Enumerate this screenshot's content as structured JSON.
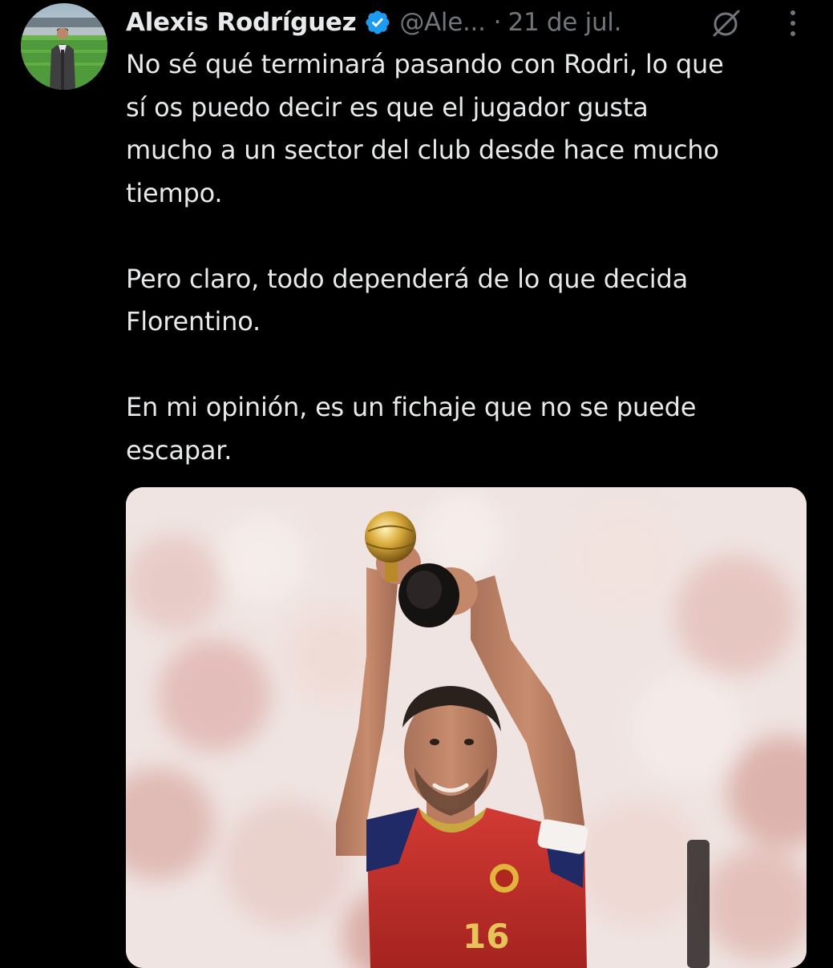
{
  "tweet": {
    "author": {
      "name": "Alexis Rodríguez",
      "handle": "@Ale...",
      "verified_icon": "verified-badge-icon",
      "avatar_icon": "avatar"
    },
    "separator": "·",
    "date": "21 de jul.",
    "paragraphs": [
      "No sé qué terminará pasando con Rodri, lo que\nsí os puedo decir es que el jugador gusta\nmucho a un sector del club desde hace mucho\ntiempo.",
      "Pero claro, todo dependerá de lo que decida\nFlorentino.",
      "En mi opinión, es un fichaje que no se puede\nescapar."
    ],
    "actions": {
      "grok_icon": "grok-icon",
      "more_icon": "more-options-icon"
    },
    "media": {
      "icon": "photo",
      "jersey_number": "16"
    }
  },
  "colors": {
    "background": "#000000",
    "text_primary": "#e7e9ea",
    "text_secondary": "#71767b",
    "verified_blue": "#1d9bf0"
  }
}
